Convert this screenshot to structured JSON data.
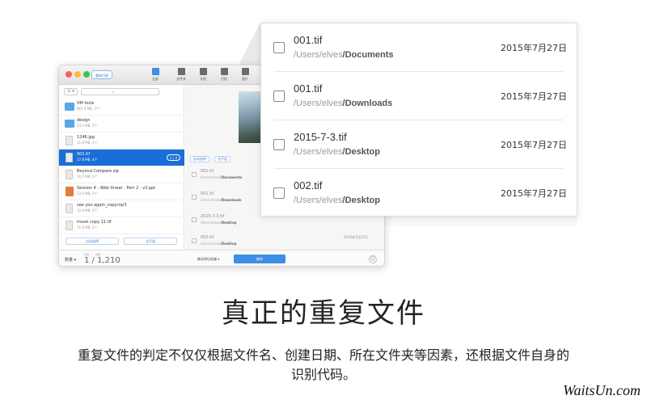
{
  "toolbar": {
    "rescan_label": "重新扫描",
    "buttons": [
      {
        "label": "全部",
        "icon": "all-icon",
        "active": true
      },
      {
        "label": "文件夹",
        "icon": "folder-icon"
      },
      {
        "label": "文档",
        "icon": "document-icon"
      },
      {
        "label": "归档",
        "icon": "archive-icon"
      },
      {
        "label": "图片",
        "icon": "image-icon"
      }
    ]
  },
  "sidebar": {
    "view_toggle": "☷ ▾",
    "files": [
      {
        "name": "VM tools",
        "size": "867.6 MB, 2个",
        "kind": "folder"
      },
      {
        "name": "design",
        "size": "23.3 MB, 3个",
        "kind": "folder"
      },
      {
        "name": "1246.jpg",
        "size": "11.8 MB, 2个",
        "kind": "doc"
      },
      {
        "name": "001.tif",
        "size": "17.8 MB, 4个",
        "kind": "img",
        "badge": "1 / 4",
        "selected": true
      },
      {
        "name": "Beyond Compare.zip",
        "size": "16.5 MB, 2个",
        "kind": "doc"
      },
      {
        "name": "Session 4 - Web threat - Part 2 - v2.ppt",
        "size": "13.0 MB, 2个",
        "kind": "ppt"
      },
      {
        "name": "see you again_copy.mp3",
        "size": "12.8 MB, 2个",
        "kind": "doc"
      },
      {
        "name": "travel copy 11.tif",
        "size": "11.6 MB, 2个",
        "kind": "img"
      }
    ],
    "auto_select": "自动选择",
    "deselect_all": "全不选"
  },
  "preview": {
    "auto_select": "自动选择",
    "deselect_all": "全不选",
    "mini_items": [
      {
        "name": "001.tif",
        "path_prefix": "/Users/elves",
        "path_folder": "/Documents"
      },
      {
        "name": "001.tif",
        "path_prefix": "/Users/elves",
        "path_folder": "/Downloads"
      },
      {
        "name": "2015-7-3.tif",
        "path_prefix": "/Users/elves",
        "path_folder": "/Desktop"
      },
      {
        "name": "002.tif",
        "path_prefix": "/Users/elves",
        "path_folder": "/Desktop"
      }
    ],
    "last_date": "2015年7月27日"
  },
  "statusbar": {
    "quantity": "数量 ▾",
    "selected_label": "已选",
    "total_label": "总数",
    "count": "1 / 1,210",
    "move_to": "移动到垃圾箱 ▾",
    "delete": "移除",
    "face_icon": "☺"
  },
  "zoom": {
    "rows": [
      {
        "name": "001.tif",
        "path_prefix": "/Users/elves",
        "path_folder": "/Documents",
        "date": "2015年7月27日"
      },
      {
        "name": "001.tif",
        "path_prefix": "/Users/elves",
        "path_folder": "/Downloads",
        "date": "2015年7月27日"
      },
      {
        "name": "2015-7-3.tif",
        "path_prefix": "/Users/elves",
        "path_folder": "/Desktop",
        "date": "2015年7月27日"
      },
      {
        "name": "002.tif",
        "path_prefix": "/Users/elves",
        "path_folder": "/Desktop",
        "date": "2015年7月27日"
      }
    ]
  },
  "marketing": {
    "headline": "真正的重复文件",
    "description": "重复文件的判定不仅仅根据文件名、创建日期、所在文件夹等因素，还根据文件自身的识别代码。"
  },
  "watermark": "WaitsUn.com",
  "colors": {
    "accent": "#3d8ee6",
    "selection": "#1a6ed8"
  }
}
